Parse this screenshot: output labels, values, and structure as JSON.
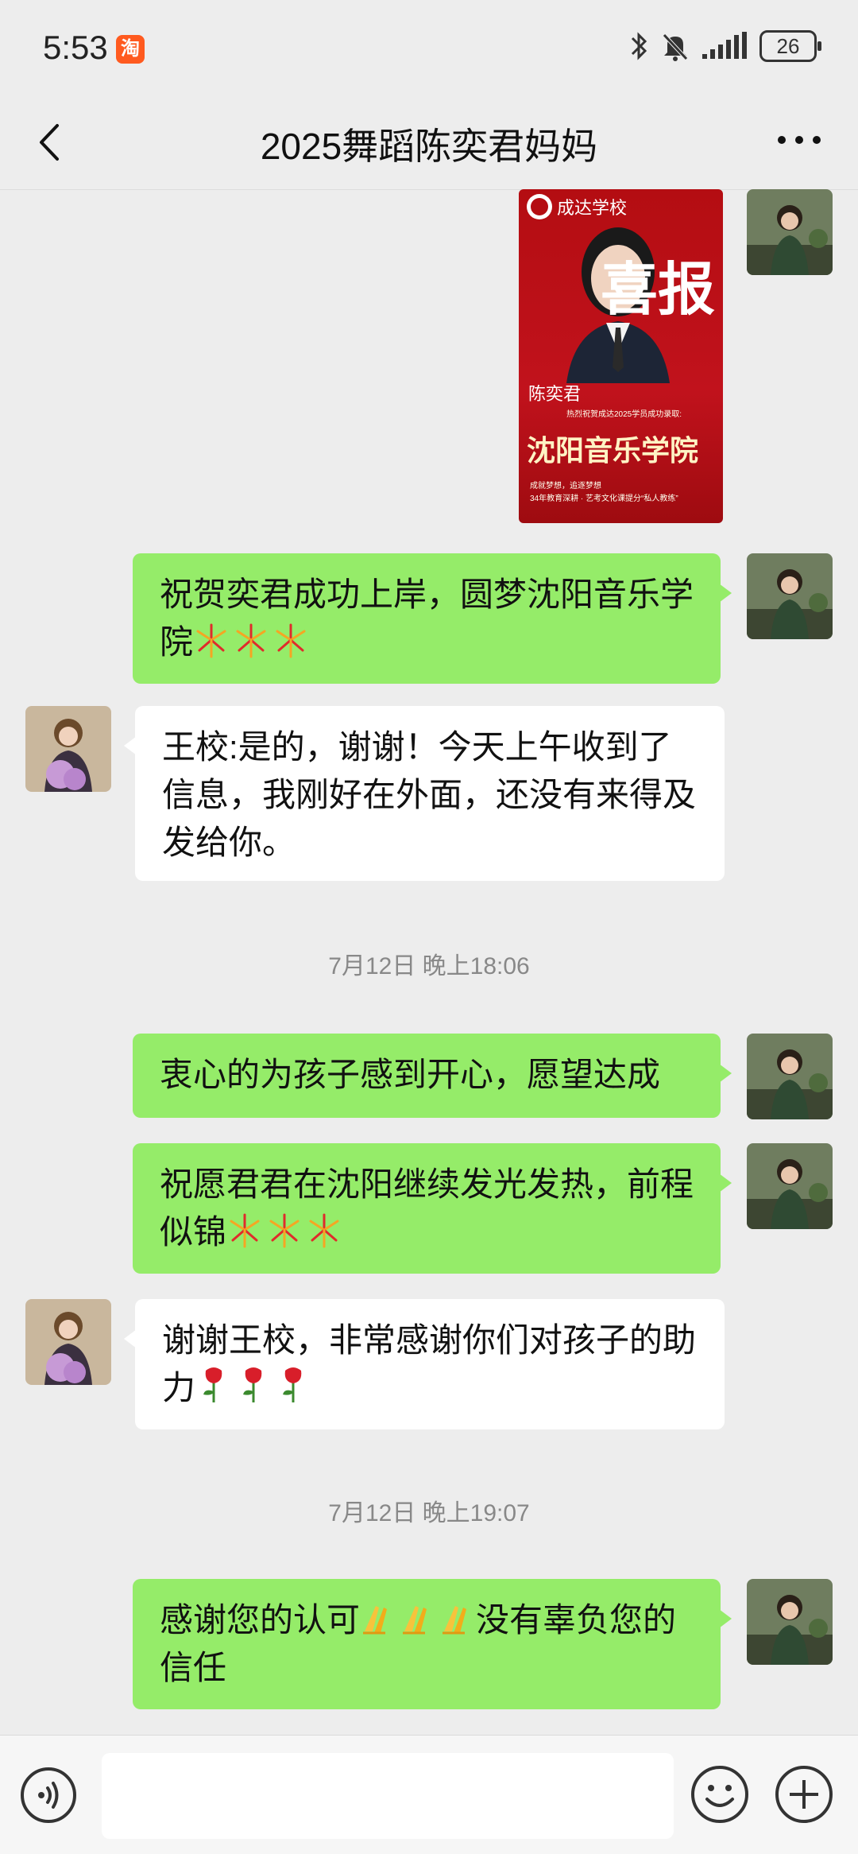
{
  "status_bar": {
    "time": "5:53",
    "app_badge": "淘",
    "battery": "26"
  },
  "header": {
    "title": "2025舞蹈陈奕君妈妈"
  },
  "poster": {
    "school": "成达学校",
    "headline": "喜报",
    "student_name": "陈奕君",
    "college": "沈阳音乐学院",
    "caption": "热烈祝贺成达2025学员成功录取:",
    "footer_1": "成就梦想，追逐梦想",
    "footer_2": "34年教育深耕 · 艺考文化课提分“私人教练”"
  },
  "messages": [
    {
      "side": "right",
      "text": "祝贺奕君成功上岸，圆梦沈阳音乐学院",
      "emoji": "firework",
      "emoji_count": 3
    },
    {
      "side": "left",
      "text": "王校:是的，谢谢！今天上午收到了信息，我刚好在外面，还没有来得及发给你。"
    },
    {
      "timestamp": "7月12日 晚上18:06"
    },
    {
      "side": "right",
      "text": "衷心的为孩子感到开心，愿望达成"
    },
    {
      "side": "right",
      "text": "祝愿君君在沈阳继续发光发热，前程似锦",
      "emoji": "firework",
      "emoji_count": 3
    },
    {
      "side": "left",
      "text": "谢谢王校，非常感谢你们对孩子的助力",
      "emoji": "rose",
      "emoji_count": 3
    },
    {
      "timestamp": "7月12日 晚上19:07"
    },
    {
      "side": "right",
      "text_before": "感谢您的认可",
      "emoji": "clap",
      "emoji_count": 3,
      "text_after": "没有辜负您的信任"
    }
  ],
  "colors": {
    "green_bubble": "#95ec69",
    "white_bubble": "#ffffff",
    "background": "#ededed"
  }
}
